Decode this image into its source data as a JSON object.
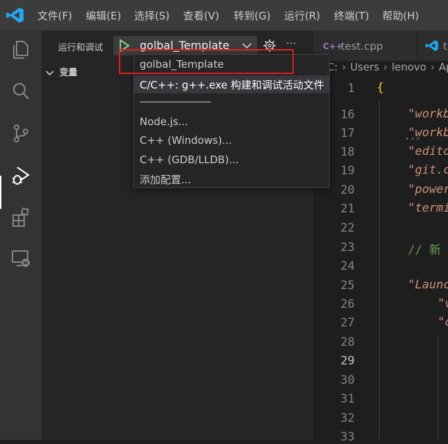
{
  "menu": [
    "文件(F)",
    "编辑(E)",
    "选择(S)",
    "查看(V)",
    "转到(G)",
    "运行(R)",
    "终端(T)",
    "帮助(H)"
  ],
  "activity_bar": [
    "explorer-icon",
    "search-icon",
    "source-control-icon",
    "run-debug-icon",
    "extensions-icon",
    "remote-explorer-icon"
  ],
  "debug": {
    "run_label": "运行和调试",
    "selected_config": "golbal_Template",
    "variables_label": "变量"
  },
  "dropdown": {
    "items": [
      "golbal_Template",
      "C/C++: g++.exe 构建和调试活动文件",
      "Node.js...",
      "C++ (Windows)...",
      "C++ (GDB/LLDB)...",
      "添加配置..."
    ]
  },
  "tabs": [
    {
      "icon": "C++",
      "label": "test.cpp"
    },
    {
      "icon": "vscode-icon",
      "label": "t"
    }
  ],
  "breadcrumb": [
    "C:",
    "Users",
    "lenovo",
    "Ap"
  ],
  "editor": {
    "line_numbers": [
      "1",
      "16",
      "17",
      "18",
      "19",
      "20",
      "21",
      "22",
      "23",
      "24",
      "25",
      "26",
      "27",
      "28",
      "29",
      "30",
      "31",
      "32",
      "33"
    ],
    "current_line": "29",
    "line_1_code": "{",
    "code_fragments": [
      "\"workb",
      "\"workb",
      "\"edito",
      "\"git.c",
      "\"power",
      "\"termi",
      "//  新",
      "\"Launc",
      "\"v",
      "\"c"
    ],
    "inline_hint": "···"
  },
  "colors": {
    "accent_red_box": "#e0201b",
    "play_green": "#89d185",
    "vscode_blue": "#23a7f1"
  }
}
